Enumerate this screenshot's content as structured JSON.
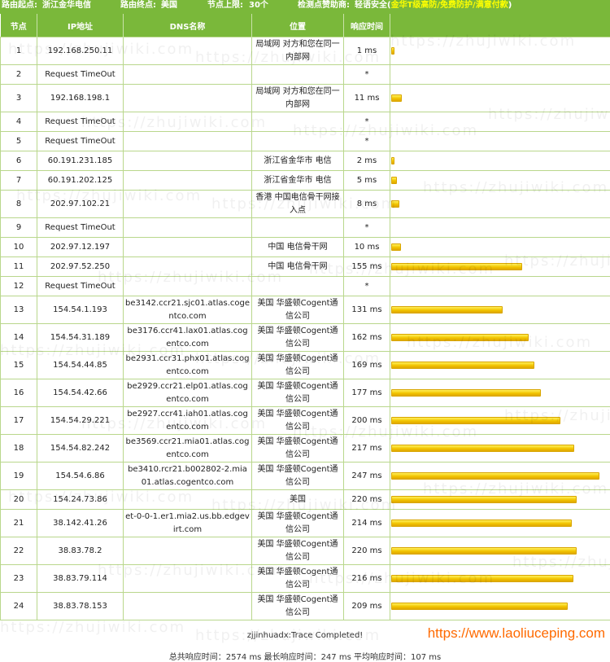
{
  "header": {
    "origin_label": "路由起点:",
    "origin_value": "浙江金华电信",
    "dest_label": "路由终点:",
    "dest_value": "美国",
    "limit_label": "节点上限:",
    "limit_value": "30个",
    "sponsor_label": "检测点赞助商:",
    "sponsor_name": "轻语安全",
    "sponsor_link": "金华T级高防/免费防护/满意付款"
  },
  "columns": [
    "节点",
    "IP地址",
    "DNS名称",
    "位置",
    "响应时间",
    ""
  ],
  "rows": [
    {
      "hop": "1",
      "ip": "192.168.250.11",
      "dns": "",
      "loc": "局域网 对方和您在同一内部网",
      "time": "1 ms",
      "ms": 1
    },
    {
      "hop": "2",
      "ip": "Request TimeOut",
      "dns": "",
      "loc": "",
      "time": "*",
      "ms": 0
    },
    {
      "hop": "3",
      "ip": "192.168.198.1",
      "dns": "",
      "loc": "局域网 对方和您在同一内部网",
      "time": "11 ms",
      "ms": 11
    },
    {
      "hop": "4",
      "ip": "Request TimeOut",
      "dns": "",
      "loc": "",
      "time": "*",
      "ms": 0
    },
    {
      "hop": "5",
      "ip": "Request TimeOut",
      "dns": "",
      "loc": "",
      "time": "*",
      "ms": 0
    },
    {
      "hop": "6",
      "ip": "60.191.231.185",
      "dns": "",
      "loc": "浙江省金华市 电信",
      "time": "2 ms",
      "ms": 2
    },
    {
      "hop": "7",
      "ip": "60.191.202.125",
      "dns": "",
      "loc": "浙江省金华市 电信",
      "time": "5 ms",
      "ms": 5
    },
    {
      "hop": "8",
      "ip": "202.97.102.21",
      "dns": "",
      "loc": "香港 中国电信骨干网接入点",
      "time": "8 ms",
      "ms": 8
    },
    {
      "hop": "9",
      "ip": "Request TimeOut",
      "dns": "",
      "loc": "",
      "time": "*",
      "ms": 0
    },
    {
      "hop": "10",
      "ip": "202.97.12.197",
      "dns": "",
      "loc": "中国 电信骨干网",
      "time": "10 ms",
      "ms": 10
    },
    {
      "hop": "11",
      "ip": "202.97.52.250",
      "dns": "",
      "loc": "中国 电信骨干网",
      "time": "155 ms",
      "ms": 155
    },
    {
      "hop": "12",
      "ip": "Request TimeOut",
      "dns": "",
      "loc": "",
      "time": "*",
      "ms": 0
    },
    {
      "hop": "13",
      "ip": "154.54.1.193",
      "dns": "be3142.ccr21.sjc01.atlas.cogentco.com",
      "loc": "美国 华盛顿Cogent通信公司",
      "time": "131 ms",
      "ms": 131
    },
    {
      "hop": "14",
      "ip": "154.54.31.189",
      "dns": "be3176.ccr41.lax01.atlas.cogentco.com",
      "loc": "美国 华盛顿Cogent通信公司",
      "time": "162 ms",
      "ms": 162
    },
    {
      "hop": "15",
      "ip": "154.54.44.85",
      "dns": "be2931.ccr31.phx01.atlas.cogentco.com",
      "loc": "美国 华盛顿Cogent通信公司",
      "time": "169 ms",
      "ms": 169
    },
    {
      "hop": "16",
      "ip": "154.54.42.66",
      "dns": "be2929.ccr21.elp01.atlas.cogentco.com",
      "loc": "美国 华盛顿Cogent通信公司",
      "time": "177 ms",
      "ms": 177
    },
    {
      "hop": "17",
      "ip": "154.54.29.221",
      "dns": "be2927.ccr41.iah01.atlas.cogentco.com",
      "loc": "美国 华盛顿Cogent通信公司",
      "time": "200 ms",
      "ms": 200
    },
    {
      "hop": "18",
      "ip": "154.54.82.242",
      "dns": "be3569.ccr21.mia01.atlas.cogentco.com",
      "loc": "美国 华盛顿Cogent通信公司",
      "time": "217 ms",
      "ms": 217
    },
    {
      "hop": "19",
      "ip": "154.54.6.86",
      "dns": "be3410.rcr21.b002802-2.mia01.atlas.cogentco.com",
      "loc": "美国 华盛顿Cogent通信公司",
      "time": "247 ms",
      "ms": 247
    },
    {
      "hop": "20",
      "ip": "154.24.73.86",
      "dns": "",
      "loc": "美国",
      "time": "220 ms",
      "ms": 220
    },
    {
      "hop": "21",
      "ip": "38.142.41.26",
      "dns": "et-0-0-1.er1.mia2.us.bb.edgevirt.com",
      "loc": "美国 华盛顿Cogent通信公司",
      "time": "214 ms",
      "ms": 214
    },
    {
      "hop": "22",
      "ip": "38.83.78.2",
      "dns": "",
      "loc": "美国 华盛顿Cogent通信公司",
      "time": "220 ms",
      "ms": 220
    },
    {
      "hop": "23",
      "ip": "38.83.79.114",
      "dns": "",
      "loc": "美国 华盛顿Cogent通信公司",
      "time": "216 ms",
      "ms": 216
    },
    {
      "hop": "24",
      "ip": "38.83.78.153",
      "dns": "",
      "loc": "美国 华盛顿Cogent通信公司",
      "time": "209 ms",
      "ms": 209
    }
  ],
  "max_ms": 247,
  "footer": {
    "status": "zjjinhuadx:Trace Completed!",
    "summary": "总共响应时间：2574 ms    最长响应时间：247 ms    平均响应时间：107 ms"
  },
  "watermark_text": "https://zhujiwiki.com",
  "brand_url": "https://www.laoliuceping.com",
  "colors": {
    "header_green": "#7ab83a",
    "bar_yellow": "#f2c400",
    "link_yellow": "#ffff00",
    "brand_orange": "#ff6a00"
  }
}
